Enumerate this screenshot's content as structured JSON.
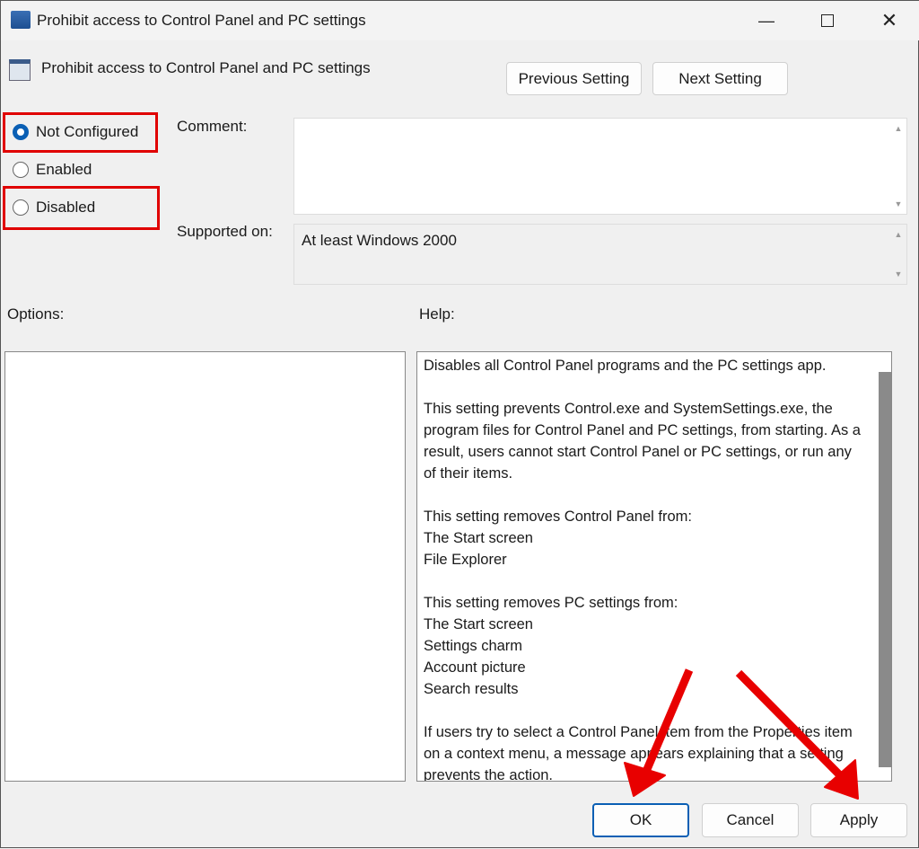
{
  "window": {
    "title": "Prohibit access to Control Panel and PC settings",
    "minimize_icon": "minimize-icon",
    "maximize_icon": "maximize-icon",
    "close_icon": "close-icon"
  },
  "header": {
    "setting_name": "Prohibit access to Control Panel and PC settings",
    "previous_label": "Previous Setting",
    "next_label": "Next Setting"
  },
  "state": {
    "options": [
      {
        "label": "Not Configured",
        "selected": true
      },
      {
        "label": "Enabled",
        "selected": false
      },
      {
        "label": "Disabled",
        "selected": false
      }
    ]
  },
  "comment": {
    "label": "Comment:",
    "value": ""
  },
  "supported": {
    "label": "Supported on:",
    "value": "At least Windows 2000"
  },
  "options_label": "Options:",
  "help_label": "Help:",
  "help_paragraphs": [
    [
      "Disables all Control Panel programs and the PC settings app."
    ],
    [
      "This setting prevents Control.exe and SystemSettings.exe, the",
      "program files for Control Panel and PC settings, from starting. As a",
      "result, users cannot start Control Panel or PC settings, or run any",
      "of their items."
    ],
    [
      "This setting removes Control Panel from:",
      "The Start screen",
      "File Explorer"
    ],
    [
      "This setting removes PC settings from:",
      "The Start screen",
      "Settings charm",
      "Account picture",
      "Search results"
    ],
    [
      "If users try to select a Control Panel item from the Properties item",
      "on a context menu, a message appears explaining that a setting",
      "prevents the action."
    ]
  ],
  "footer": {
    "ok_label": "OK",
    "cancel_label": "Cancel",
    "apply_label": "Apply"
  },
  "colors": {
    "highlight": "#e00000",
    "accent": "#0a5fb4",
    "arrow": "#e80000"
  }
}
